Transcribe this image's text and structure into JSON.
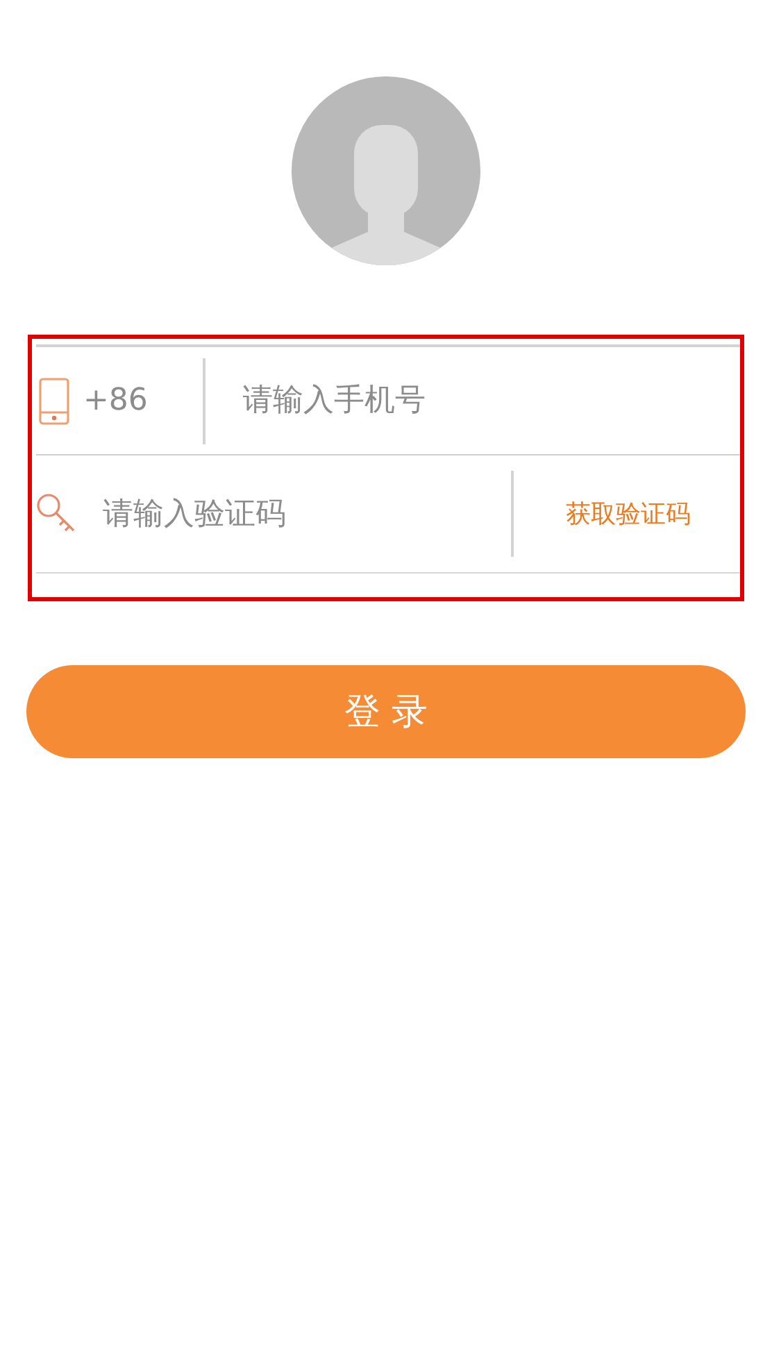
{
  "phone_row": {
    "country_code": "+86",
    "placeholder": "请输入手机号"
  },
  "code_row": {
    "placeholder": "请输入验证码",
    "get_code_button": "获取验证码"
  },
  "login_button": "登 录"
}
